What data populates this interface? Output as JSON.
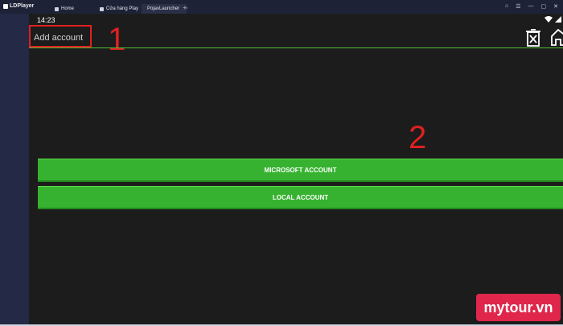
{
  "emulator": {
    "brand": "LDPlayer",
    "tabs": [
      {
        "label": "Home"
      },
      {
        "label": "Cửa hàng Play"
      },
      {
        "label": "PojavLauncher"
      }
    ],
    "tab_close": "×",
    "tab_add": "+"
  },
  "status_bar": {
    "time": "14:23",
    "wifi_icon": "wifi-icon",
    "signal_icon": "signal-icon"
  },
  "header": {
    "title": "Add account",
    "actions": [
      "trash-icon",
      "home-icon"
    ]
  },
  "annotations": {
    "label_1": "1",
    "label_2": "2",
    "color": "#e02020"
  },
  "accounts": {
    "microsoft_label": "MICROSOFT ACCOUNT",
    "local_label": "LOCAL ACCOUNT",
    "button_color": "#36b230"
  },
  "watermark": {
    "text": "mytour.vn",
    "color": "#e0274b"
  }
}
